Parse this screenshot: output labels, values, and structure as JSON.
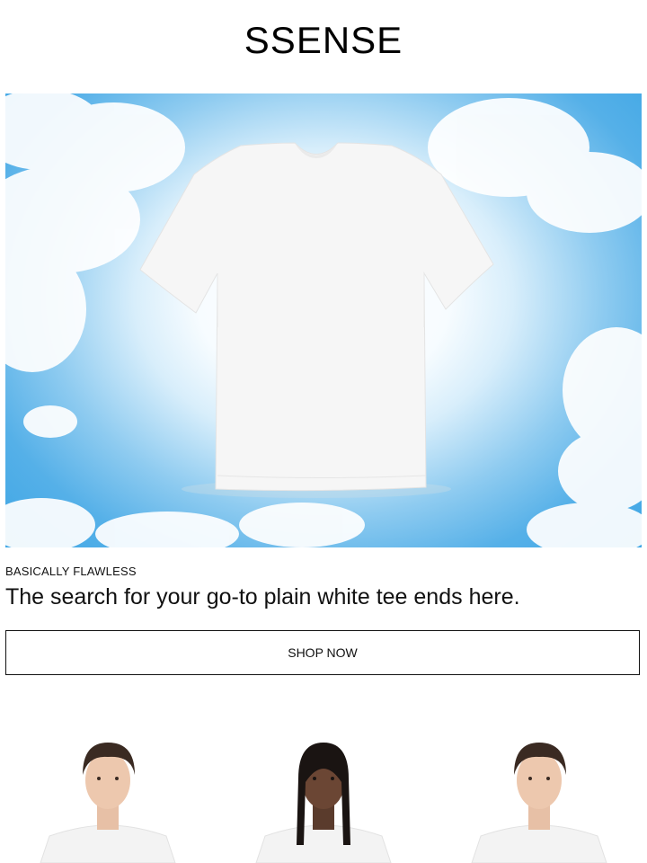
{
  "header": {
    "logo": "SSENSE"
  },
  "hero": {
    "image": "white-tee-on-clouds-image"
  },
  "promo": {
    "eyebrow": "BASICALLY FLAWLESS",
    "headline": "The search for your go-to plain white tee ends here.",
    "cta_label": "SHOP NOW"
  },
  "products": [
    {
      "image": "model-white-tee-image"
    },
    {
      "image": "model-white-tee-image"
    },
    {
      "image": "model-white-tee-image"
    }
  ],
  "colors": {
    "text": "#111111",
    "background": "#ffffff",
    "sky": "#3ea6e5"
  }
}
